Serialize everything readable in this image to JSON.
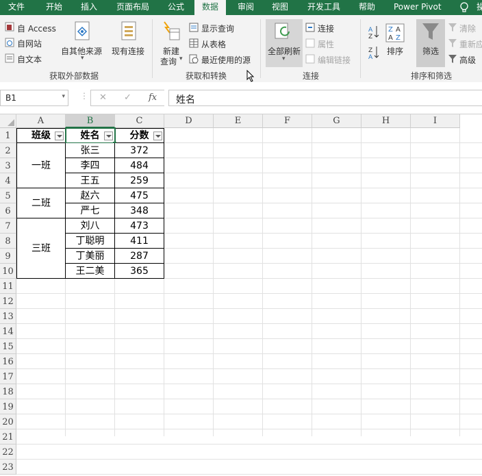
{
  "menu": {
    "tabs": [
      "文件",
      "开始",
      "插入",
      "页面布局",
      "公式",
      "数据",
      "审阅",
      "视图",
      "开发工具",
      "帮助",
      "Power Pivot"
    ],
    "active": "数据",
    "search_icon": "lightbulb-icon",
    "trailing": "操"
  },
  "ribbon": {
    "external": {
      "access": "自 Access",
      "web": "自网站",
      "text": "自文本",
      "other": "自其他来源",
      "existing": "现有连接",
      "group": "获取外部数据"
    },
    "transform": {
      "new_query_1": "新建",
      "new_query_2": "查询",
      "show_queries": "显示查询",
      "from_table": "从表格",
      "recent": "最近使用的源",
      "group": "获取和转换"
    },
    "connections": {
      "refresh": "全部刷新",
      "connections": "连接",
      "properties": "属性",
      "edit_links": "编辑链接",
      "group": "连接"
    },
    "sort_filter": {
      "sort": "排序",
      "filter": "筛选",
      "clear": "清除",
      "reapply": "重新应",
      "advanced": "高级",
      "group": "排序和筛选"
    }
  },
  "formula_bar": {
    "name_box": "B1",
    "cancel": "✕",
    "enter": "✓",
    "fx": "fx",
    "content": "姓名"
  },
  "sheet": {
    "columns": [
      "A",
      "B",
      "C",
      "D",
      "E",
      "F",
      "G",
      "H",
      "I"
    ],
    "selected_column": "B",
    "rows": [
      "1",
      "2",
      "3",
      "4",
      "5",
      "6",
      "7",
      "8",
      "9",
      "10",
      "11",
      "12",
      "13",
      "14",
      "15",
      "16",
      "17",
      "18",
      "19",
      "20",
      "21",
      "22",
      "23"
    ],
    "headers": [
      "班级",
      "姓名",
      "分数"
    ],
    "classes": [
      "一班",
      "二班",
      "三班"
    ],
    "names": [
      "张三",
      "李四",
      "王五",
      "赵六",
      "严七",
      "刘八",
      "丁聪明",
      "丁美丽",
      "王二美"
    ],
    "scores": [
      "372",
      "484",
      "259",
      "475",
      "348",
      "473",
      "411",
      "287",
      "365"
    ]
  },
  "colors": {
    "accent": "#217346"
  }
}
